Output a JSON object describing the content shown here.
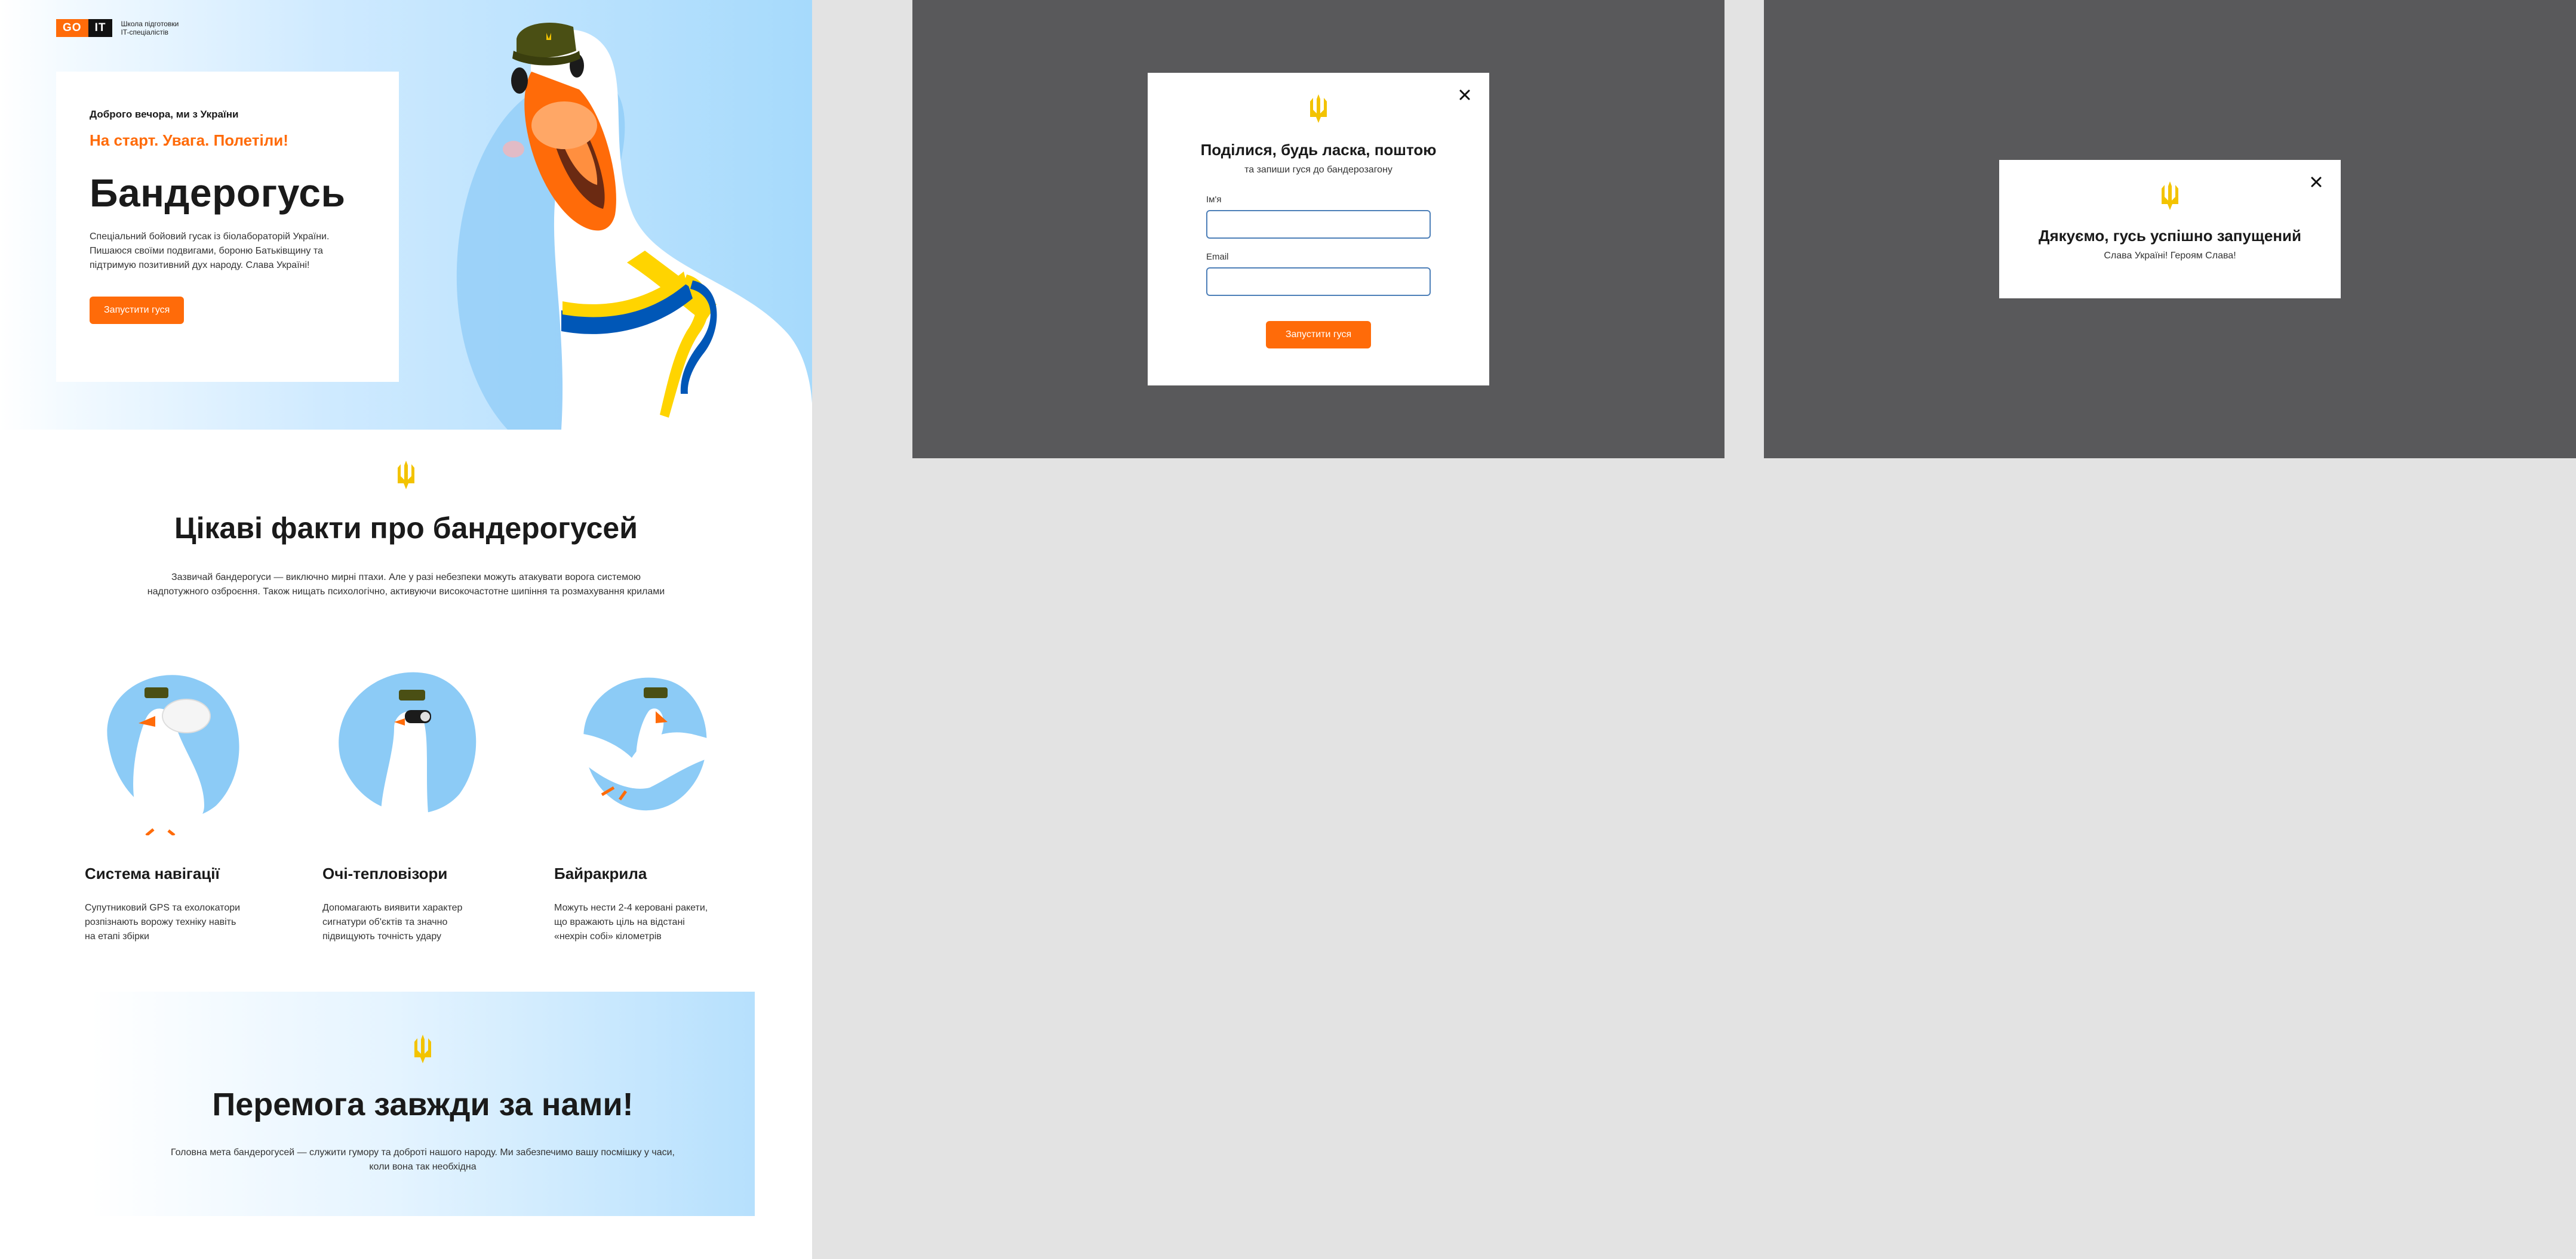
{
  "logo": {
    "go": "GO",
    "it": "IT",
    "tagline_line1": "Школа підготовки",
    "tagline_line2": "IT-спеціалістів"
  },
  "hero": {
    "greeting": "Доброго вечора, ми з України",
    "slogan": "На старт. Увага. Полетіли!",
    "title": "Бандерогусь",
    "description": "Спеціальний бойовий гусак із біолабораторій України. Пишаюся своїми подвигами, бороню Батьківщину та підтримую позитивний дух народу. Слава Україні!",
    "button_label": "Запустити гуся"
  },
  "facts": {
    "title": "Цікаві факти про бандерогусей",
    "intro": "Зазвичай бандерогуси — виключно мирні птахи. Але у разі небезпеки можуть атакувати ворога системою надпотужного озброєння. Також нищать психологічно, активуючи високочастотне шипіння та розмахування крилами",
    "items": [
      {
        "title": "Система навігації",
        "description": "Супутниковий GPS та ехолокатори розпізнають ворожу техніку навіть на етапі збірки"
      },
      {
        "title": "Очі-тепловізори",
        "description": "Допомагають виявити характер сигнатури об'єктів та значно підвищують точність удару"
      },
      {
        "title": "Байракрила",
        "description": "Можуть нести 2-4 керовані ракети, що вражають ціль на відстані «нехрін собі» кілометрів"
      }
    ]
  },
  "victory": {
    "title": "Перемога завжди за нами!",
    "description": "Головна мета бандерогусей — служити гумору та доброті нашого народу. Ми забезпечимо вашу посмішку у часи, коли вона так необхідна"
  },
  "modal_form": {
    "title": "Поділися, будь ласка, поштою",
    "subtitle": "та запиши гуся до бандерозагону",
    "name_label": "Ім'я",
    "name_value": "",
    "email_label": "Email",
    "email_value": "",
    "submit_label": "Запустити гуся"
  },
  "modal_success": {
    "title": "Дякуємо, гусь успішно запущений",
    "subtitle": "Слава Україні! Героям Слава!"
  },
  "icons": {
    "trident": "trident-icon",
    "close": "close-icon"
  },
  "colors": {
    "accent": "#ff6b09",
    "trident_gold": "#f3c300",
    "sky_blue": "#a6dafc",
    "overlay": "#59595b",
    "input_border": "#4d7fb8"
  }
}
